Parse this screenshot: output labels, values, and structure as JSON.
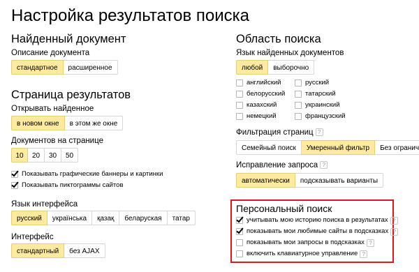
{
  "page": {
    "title": "Настройка результатов поиска"
  },
  "found_document": {
    "title": "Найденный документ",
    "description_label": "Описание документа",
    "options": [
      "стандартное",
      "расширенное"
    ],
    "selected": 0
  },
  "results_page": {
    "title": "Страница результатов",
    "open_label": "Открывать найденное",
    "open_options": [
      "в новом окне",
      "в этом же окне"
    ],
    "open_selected": 0,
    "docs_per_page_label": "Документов на странице",
    "docs_per_page_options": [
      "10",
      "20",
      "30",
      "50"
    ],
    "docs_per_page_selected": 0,
    "checkboxes": [
      {
        "label": "Показывать графические баннеры и картинки",
        "checked": true
      },
      {
        "label": "Показывать пиктограммы сайтов",
        "checked": true
      }
    ]
  },
  "interface_language": {
    "title": "Язык интерфейса",
    "options": [
      "русский",
      "українська",
      "қазақ",
      "беларуская",
      "татар"
    ],
    "selected": 0
  },
  "interface": {
    "title": "Интерфейс",
    "options": [
      "стандартный",
      "без AJAX"
    ],
    "selected": 0
  },
  "search_area": {
    "title": "Область поиска",
    "doc_language_label": "Язык найденных документов",
    "doc_language_options": [
      "любой",
      "выборочно"
    ],
    "doc_language_selected": 0,
    "languages": [
      {
        "label": "английский",
        "checked": false
      },
      {
        "label": "русский",
        "checked": false
      },
      {
        "label": "белорусский",
        "checked": false
      },
      {
        "label": "татарский",
        "checked": false
      },
      {
        "label": "казахский",
        "checked": false
      },
      {
        "label": "украинский",
        "checked": false
      },
      {
        "label": "немецкий",
        "checked": false
      },
      {
        "label": "французский",
        "checked": false
      }
    ]
  },
  "filtering": {
    "title": "Фильтрация страниц",
    "help": "?",
    "options": [
      "Семейный поиск",
      "Умеренный фильтр",
      "Без ограничений"
    ],
    "selected": 1
  },
  "correction": {
    "title": "Исправление запроса",
    "help": "?",
    "options": [
      "автоматически",
      "подсказывать варианты"
    ],
    "selected": 0
  },
  "personal_search": {
    "title": "Персональный поиск",
    "items": [
      {
        "label": "учитывать мою историю поиска в результатах",
        "checked": true,
        "help": "?"
      },
      {
        "label": "показывать мои любимые сайты в подсказках",
        "checked": true,
        "help": "?"
      },
      {
        "label": "показывать мои запросы в подсказках",
        "checked": false,
        "help": "?"
      },
      {
        "label": "включить клавиатурное управление",
        "checked": false,
        "help": "?"
      }
    ],
    "highlight_color": "#e0161d"
  },
  "colors": {
    "selected_bg": "#ffeba0",
    "border": "#d6d6d6"
  }
}
